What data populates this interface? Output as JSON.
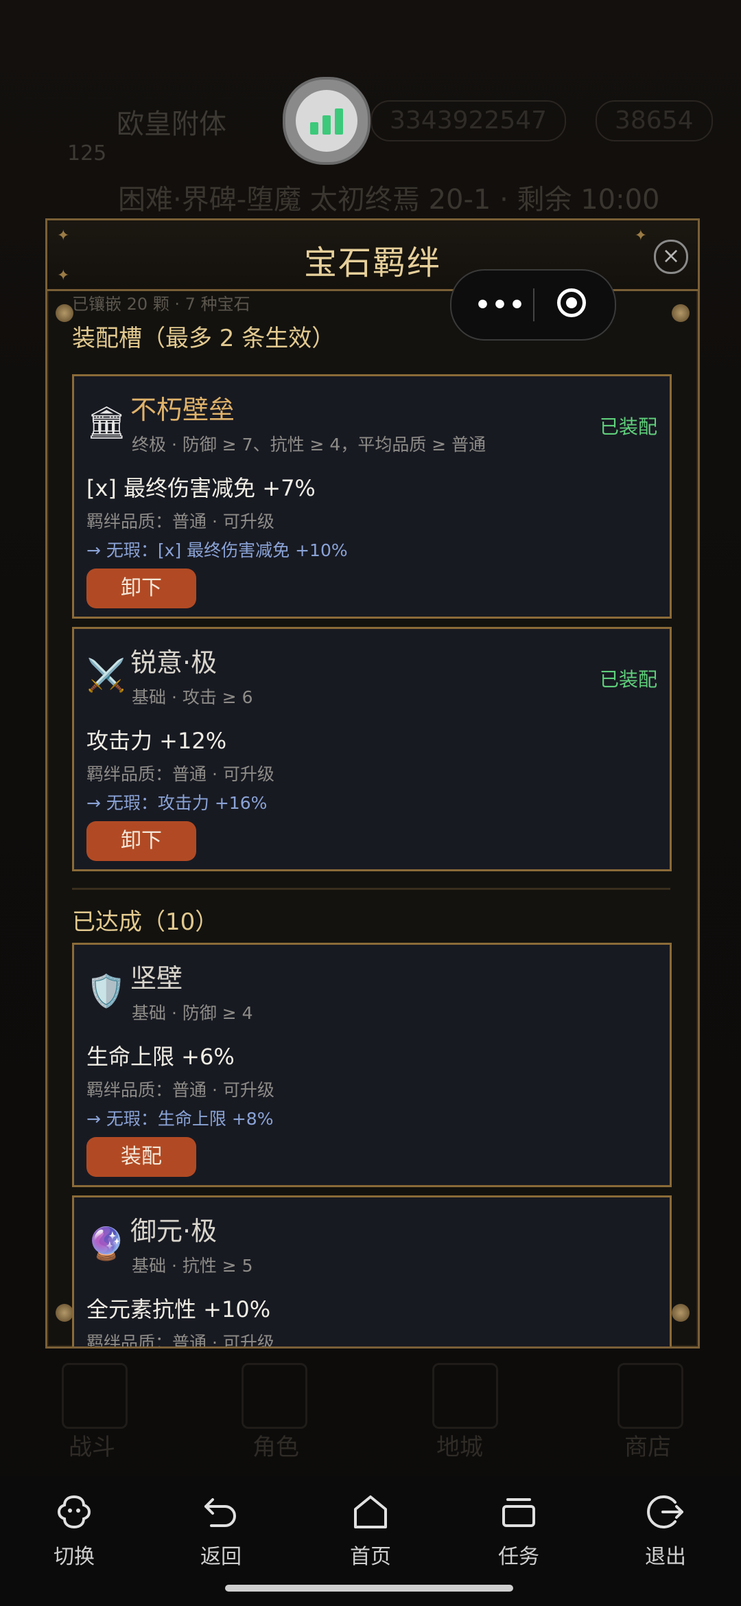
{
  "background": {
    "player_name": "欧皇附体",
    "level": "125",
    "currency_1": "3343922547",
    "currency_2": "38654",
    "stage": "困难·界碑-堕魔  太初终焉 20-1 · 剩余 10:00",
    "nav": [
      "战斗",
      "角色",
      "地城",
      "商店"
    ]
  },
  "modal": {
    "title": "宝石羁绊",
    "summary": "已镶嵌 20 颗 · 7 种宝石",
    "slots_title": "装配槽（最多 2 条生效）",
    "achieved_title": "已达成（10）",
    "equipped_cards": [
      {
        "icon": "🏛",
        "name": "不朽壁垒",
        "requirement": "终极 · 防御 ≥ 7、抗性 ≥ 4，平均品质 ≥ 普通",
        "status": "已装配",
        "effect": "[x] 最终伤害减免 +7%",
        "quality": "羁绊品质：普通 · 可升级",
        "upgrade": "→ 无瑕：[x] 最终伤害减免 +10%",
        "button": "卸下"
      },
      {
        "icon": "⚔️",
        "name": "锐意·极",
        "requirement": "基础 · 攻击 ≥ 6",
        "status": "已装配",
        "effect": "攻击力 +12%",
        "quality": "羁绊品质：普通 · 可升级",
        "upgrade": "→ 无瑕：攻击力 +16%",
        "button": "卸下"
      }
    ],
    "achieved_cards": [
      {
        "icon": "🛡️",
        "name": "坚壁",
        "requirement": "基础 · 防御 ≥ 4",
        "effect": "生命上限 +6%",
        "quality": "羁绊品质：普通 · 可升级",
        "upgrade": "→ 无瑕：生命上限 +8%",
        "button": "装配"
      },
      {
        "icon": "🔮",
        "name": "御元·极",
        "requirement": "基础 · 抗性 ≥ 5",
        "effect": "全元素抗性 +10%",
        "quality": "羁绊品质：普通 · 可升级"
      }
    ]
  },
  "system_bar": {
    "items": [
      {
        "label": "切换",
        "icon": "switch-icon"
      },
      {
        "label": "返回",
        "icon": "back-icon"
      },
      {
        "label": "首页",
        "icon": "home-icon"
      },
      {
        "label": "任务",
        "icon": "tasks-icon"
      },
      {
        "label": "退出",
        "icon": "exit-icon"
      }
    ]
  }
}
